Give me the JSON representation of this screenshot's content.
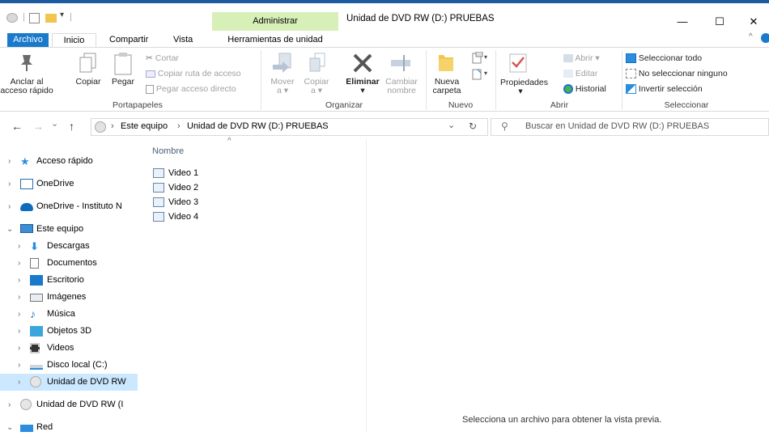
{
  "window": {
    "title": "Unidad de DVD RW (D:) PRUEBAS",
    "contextual_header": "Administrar",
    "minimize": "—",
    "maximize": "☐",
    "close": "✕"
  },
  "tabs": [
    "Archivo",
    "Inicio",
    "Compartir",
    "Vista",
    "Herramientas de unidad"
  ],
  "ribbon": {
    "portapapeles": {
      "pin_label_1": "Anclar al",
      "pin_label_2": "acceso rápido",
      "copy": "Copiar",
      "paste": "Pegar",
      "cut": "Cortar",
      "copy_path": "Copiar ruta de acceso",
      "paste_shortcut": "Pegar acceso directo",
      "label": "Portapapeles"
    },
    "organizar": {
      "move_1": "Mover",
      "move_2": "a ▾",
      "copy_1": "Copiar",
      "copy_2": "a ▾",
      "delete": "Eliminar",
      "delete_arrow": "▾",
      "rename_1": "Cambiar",
      "rename_2": "nombre",
      "label": "Organizar"
    },
    "nuevo": {
      "new_folder_1": "Nueva",
      "new_folder_2": "carpeta",
      "label": "Nuevo"
    },
    "abrir": {
      "properties": "Propiedades",
      "properties_arrow": "▾",
      "open": "Abrir ▾",
      "edit": "Editar",
      "history": "Historial",
      "label": "Abrir"
    },
    "seleccionar": {
      "select_all": "Seleccionar todo",
      "select_none": "No seleccionar ninguno",
      "invert": "Invertir selección",
      "label": "Seleccionar"
    }
  },
  "address": {
    "back": "←",
    "forward": "→",
    "recent": "⌄",
    "up": "↑",
    "crumb_sep_1": "›",
    "crumb_1": "Este equipo",
    "crumb_sep_2": "›",
    "crumb_2": "Unidad de DVD RW (D:) PRUEBAS",
    "dropdown": "⌄",
    "refresh": "↻",
    "search_placeholder": "Buscar en Unidad de DVD RW (D:) PRUEBAS"
  },
  "nav": [
    {
      "chev": "›",
      "label": "Acceso rápido"
    },
    {
      "chev": "›",
      "label": "OneDrive"
    },
    {
      "chev": "›",
      "label": "OneDrive - Instituto N"
    },
    {
      "chev": "⌄",
      "label": "Este equipo"
    },
    {
      "chev": "›",
      "label": "Descargas"
    },
    {
      "chev": "›",
      "label": "Documentos"
    },
    {
      "chev": "›",
      "label": "Escritorio"
    },
    {
      "chev": "›",
      "label": "Imágenes"
    },
    {
      "chev": "›",
      "label": "Música"
    },
    {
      "chev": "›",
      "label": "Objetos 3D"
    },
    {
      "chev": "›",
      "label": "Videos"
    },
    {
      "chev": "›",
      "label": "Disco local (C:)"
    },
    {
      "chev": "›",
      "label": "Unidad de DVD RW"
    },
    {
      "chev": "›",
      "label": "Unidad de DVD RW (I"
    },
    {
      "chev": "⌄",
      "label": "Red"
    }
  ],
  "files": {
    "column_header": "Nombre",
    "sort_indicator": "^",
    "items": [
      "Video 1",
      "Video 2",
      "Video 3",
      "Video 4"
    ]
  },
  "preview_text": "Selecciona un archivo para obtener la vista previa.",
  "colors": {
    "accent": "#1979ca",
    "context": "#d7f0b8",
    "selected": "#cce8ff"
  }
}
